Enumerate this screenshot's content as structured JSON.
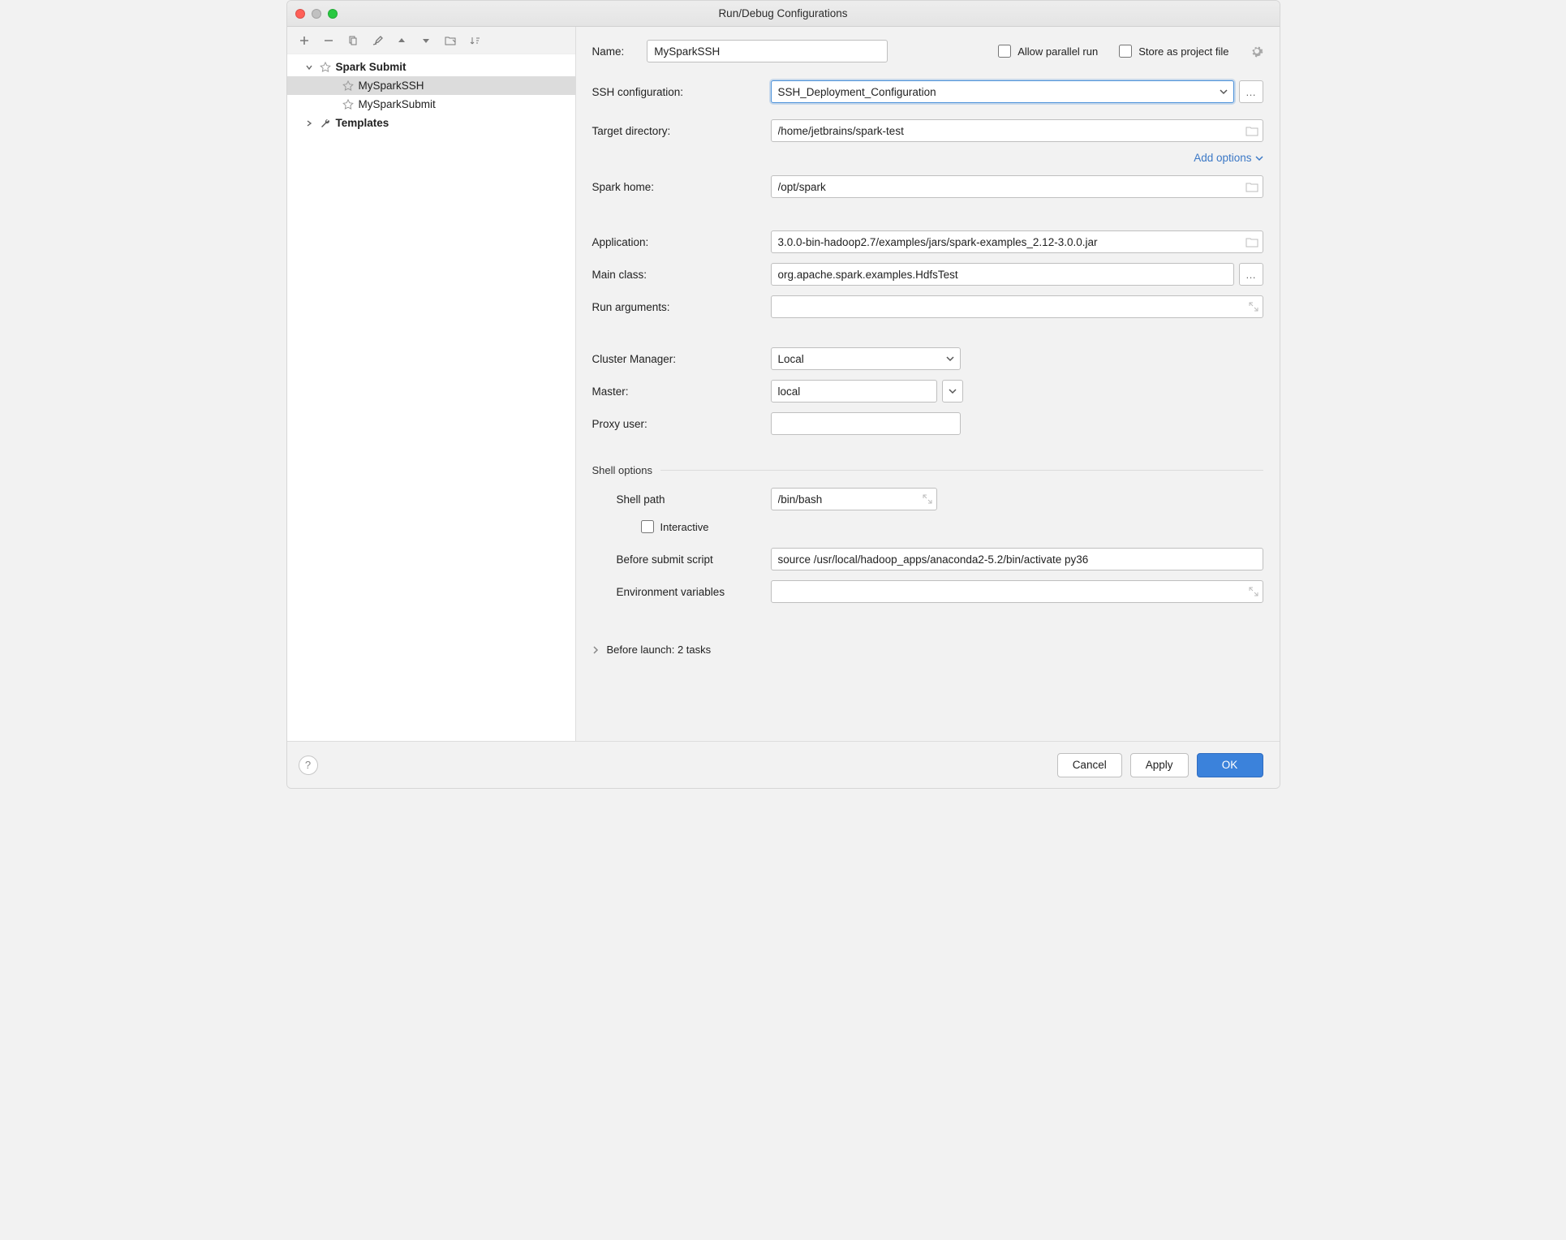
{
  "windowTitle": "Run/Debug Configurations",
  "tree": {
    "group": "Spark Submit",
    "items": [
      "MySparkSSH",
      "MySparkSubmit"
    ],
    "templates": "Templates"
  },
  "name": {
    "label": "Name:",
    "value": "MySparkSSH"
  },
  "checks": {
    "parallel": "Allow parallel run",
    "store": "Store as project file"
  },
  "ssh": {
    "label": "SSH configuration:",
    "value": "SSH_Deployment_Configuration"
  },
  "targetDir": {
    "label": "Target directory:",
    "value": "/home/jetbrains/spark-test"
  },
  "addOptions": "Add options",
  "sparkHome": {
    "label": "Spark home:",
    "value": "/opt/spark"
  },
  "application": {
    "label": "Application:",
    "value": "3.0.0-bin-hadoop2.7/examples/jars/spark-examples_2.12-3.0.0.jar"
  },
  "mainClass": {
    "label": "Main class:",
    "value": "org.apache.spark.examples.HdfsTest"
  },
  "runArgs": {
    "label": "Run arguments:",
    "value": ""
  },
  "clusterManager": {
    "label": "Cluster Manager:",
    "value": "Local"
  },
  "master": {
    "label": "Master:",
    "value": "local"
  },
  "proxy": {
    "label": "Proxy user:",
    "value": ""
  },
  "shellHeader": "Shell options",
  "shellPath": {
    "label": "Shell path",
    "value": "/bin/bash"
  },
  "interactive": "Interactive",
  "beforeSubmit": {
    "label": "Before submit script",
    "value": "source /usr/local/hadoop_apps/anaconda2-5.2/bin/activate py36"
  },
  "envVars": {
    "label": "Environment variables",
    "value": ""
  },
  "beforeLaunch": "Before launch: 2 tasks",
  "buttons": {
    "cancel": "Cancel",
    "apply": "Apply",
    "ok": "OK"
  }
}
